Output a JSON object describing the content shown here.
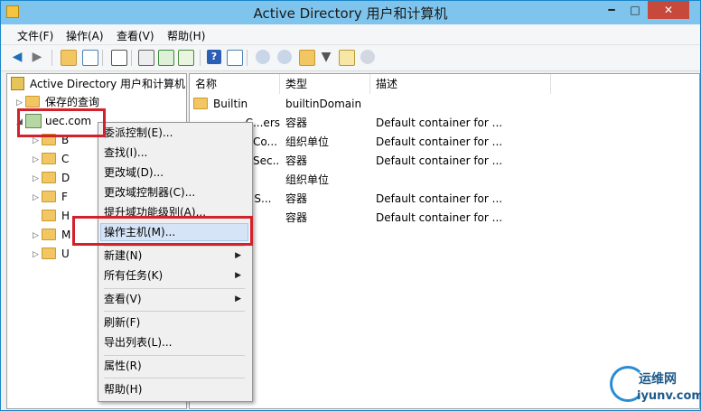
{
  "window": {
    "title": "Active Directory 用户和计算机",
    "min": "━",
    "max": "□",
    "close": "✕"
  },
  "menu": [
    "文件(F)",
    "操作(A)",
    "查看(V)",
    "帮助(H)"
  ],
  "tree": {
    "root": "Active Directory 用户和计算机",
    "saved_queries": "保存的查询",
    "domain": "uec.com",
    "children_partial": [
      "B",
      "C",
      "D",
      "F",
      "H",
      "M",
      "U"
    ]
  },
  "list": {
    "columns": [
      "名称",
      "类型",
      "描述"
    ],
    "rows": [
      {
        "name": "Builtin",
        "type": "builtinDomain",
        "desc": ""
      },
      {
        "name": "C...ers",
        "type": "容器",
        "desc": "Default container for ..."
      },
      {
        "name": "Co...",
        "type": "组织单位",
        "desc": "Default container for ..."
      },
      {
        "name": "Sec...",
        "type": "容器",
        "desc": "Default container for ..."
      },
      {
        "name": "",
        "type": "组织单位",
        "desc": ""
      },
      {
        "name": "d S...",
        "type": "容器",
        "desc": "Default container for ..."
      },
      {
        "name": "",
        "type": "容器",
        "desc": "Default container for ..."
      }
    ]
  },
  "context_menu": {
    "items": [
      {
        "label": "委派控制(E)..."
      },
      {
        "label": "查找(I)..."
      },
      {
        "label": "更改域(D)..."
      },
      {
        "label": "更改域控制器(C)..."
      },
      {
        "label": "提升域功能级别(A)..."
      },
      {
        "label": "操作主机(M)..."
      },
      {
        "label": "新建(N)"
      },
      {
        "label": "所有任务(K)"
      },
      {
        "label": "查看(V)"
      },
      {
        "label": "刷新(F)"
      },
      {
        "label": "导出列表(L)..."
      },
      {
        "label": "属性(R)"
      },
      {
        "label": "帮助(H)"
      }
    ],
    "highlighted": "操作主机(M)..."
  },
  "watermark": {
    "line1": "运维网",
    "line2": "iyunv.com"
  },
  "colors": {
    "titlebar": "#7fc4ec",
    "highlight_box": "#d3212c",
    "menu_highlight": "#d5e4f6"
  }
}
